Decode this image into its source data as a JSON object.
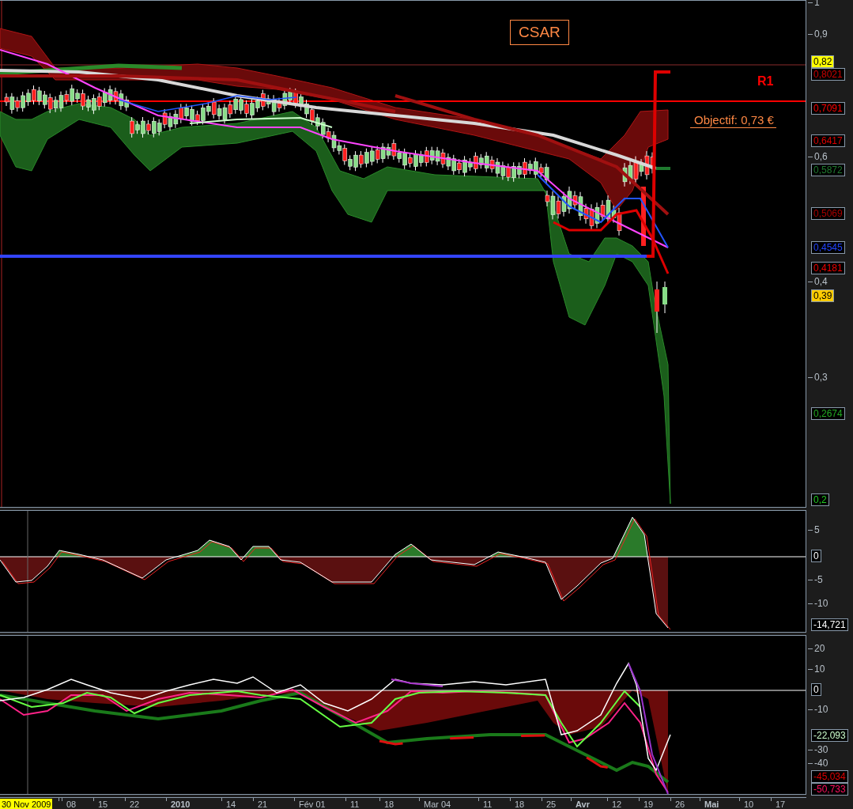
{
  "title": "CSAR",
  "resistance": {
    "label": "R1"
  },
  "target": {
    "label": "Objectif: 0,73 €"
  },
  "price_panel": {
    "axis_labels": [
      "1",
      "0,9",
      "0,6",
      "0,4",
      "0,3"
    ],
    "badges": [
      {
        "text": "0,82",
        "color": "#ffff00",
        "kind": "filled"
      },
      {
        "text": "0,8021",
        "color": "#cc0000",
        "kind": "outlined"
      },
      {
        "text": "0,7091",
        "color": "#ff0000",
        "kind": "outlined"
      },
      {
        "text": "0,6417",
        "color": "#dd0000",
        "kind": "outlined"
      },
      {
        "text": "0,5872",
        "color": "#1f7a2f",
        "kind": "outlined"
      },
      {
        "text": "0,5069",
        "color": "#aa0000",
        "kind": "outlined"
      },
      {
        "text": "0,4545",
        "color": "#2244ff",
        "kind": "outlined"
      },
      {
        "text": "0,4181",
        "color": "#ee0000",
        "kind": "outlined"
      },
      {
        "text": "0,39",
        "color": "#ffcc00",
        "kind": "filled"
      },
      {
        "text": "0,2674",
        "color": "#22aa22",
        "kind": "outlined"
      },
      {
        "text": "0,2",
        "color": "#22cc22",
        "kind": "outlined"
      }
    ]
  },
  "momentum_panel": {
    "axis_labels": [
      "5",
      "-5",
      "-10"
    ],
    "badges": [
      {
        "text": "0",
        "color": "#ffffff",
        "kind": "outlined"
      },
      {
        "text": "-14,721",
        "color": "#ffffff",
        "kind": "outlined"
      }
    ]
  },
  "oscillator_panel": {
    "axis_labels": [
      "20",
      "10",
      "-10",
      "-30",
      "-40"
    ],
    "badges": [
      {
        "text": "0",
        "color": "#ffffff",
        "kind": "outlined"
      },
      {
        "text": "-22,093",
        "color": "#ccffcc",
        "kind": "outlined"
      },
      {
        "text": "-45,034",
        "color": "#dd0000",
        "kind": "outlined"
      },
      {
        "text": "-50,733",
        "color": "#ff1060",
        "kind": "outlined"
      }
    ]
  },
  "time_axis": {
    "labels": [
      {
        "text": "30 Nov 2009",
        "kind": "current"
      },
      {
        "text": "08",
        "kind": "day"
      },
      {
        "text": "15",
        "kind": "day"
      },
      {
        "text": "22",
        "kind": "day"
      },
      {
        "text": "2010",
        "kind": "period"
      },
      {
        "text": "14",
        "kind": "day"
      },
      {
        "text": "21",
        "kind": "day"
      },
      {
        "text": "Fév 01",
        "kind": "day"
      },
      {
        "text": "11",
        "kind": "day"
      },
      {
        "text": "18",
        "kind": "day"
      },
      {
        "text": "Mar 04",
        "kind": "day"
      },
      {
        "text": "11",
        "kind": "day"
      },
      {
        "text": "18",
        "kind": "day"
      },
      {
        "text": "25",
        "kind": "day"
      },
      {
        "text": "Avr",
        "kind": "period"
      },
      {
        "text": "12",
        "kind": "day"
      },
      {
        "text": "19",
        "kind": "day"
      },
      {
        "text": "26",
        "kind": "day"
      },
      {
        "text": "Mai",
        "kind": "period"
      },
      {
        "text": "10",
        "kind": "day"
      },
      {
        "text": "17",
        "kind": "day"
      }
    ]
  }
}
